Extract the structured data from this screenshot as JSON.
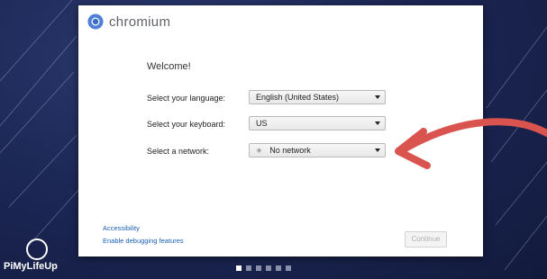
{
  "brand": {
    "name": "chromium"
  },
  "welcome": "Welcome!",
  "language": {
    "label": "Select your language:",
    "value": "English (United States)"
  },
  "keyboard": {
    "label": "Select your keyboard:",
    "value": "US"
  },
  "network": {
    "label": "Select a network:",
    "value": "No network",
    "icon": "network-icon"
  },
  "links": {
    "accessibility": "Accessibility",
    "debugging": "Enable debugging features"
  },
  "buttons": {
    "continue": "Continue"
  },
  "pagination": {
    "total": 6,
    "active": 0
  },
  "watermark": {
    "text": "PiMyLifeUp"
  },
  "colors": {
    "accent": "#1a5fb4",
    "arrow": "#d9534f"
  }
}
